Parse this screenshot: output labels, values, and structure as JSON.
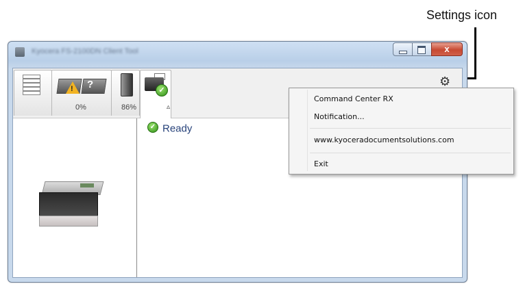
{
  "annotation": {
    "label": "Settings icon"
  },
  "window": {
    "title": "Kyocera FS-2100DN Client Tool",
    "controls": {
      "close": "x"
    }
  },
  "toolbar": {
    "tabs": [
      {
        "name": "Paper",
        "percent": ""
      },
      {
        "name": "Toner",
        "percent": "0%"
      },
      {
        "name": "Waste toner box",
        "percent": "86%"
      },
      {
        "name": "Device status",
        "percent": ""
      }
    ],
    "expand_glyph": "▵",
    "settings_glyph": "⚙"
  },
  "status": {
    "text": "Ready"
  },
  "menu": {
    "items": [
      "Command Center RX",
      "Notification...",
      "www.kyoceradocumentsolutions.com",
      "Exit"
    ]
  }
}
